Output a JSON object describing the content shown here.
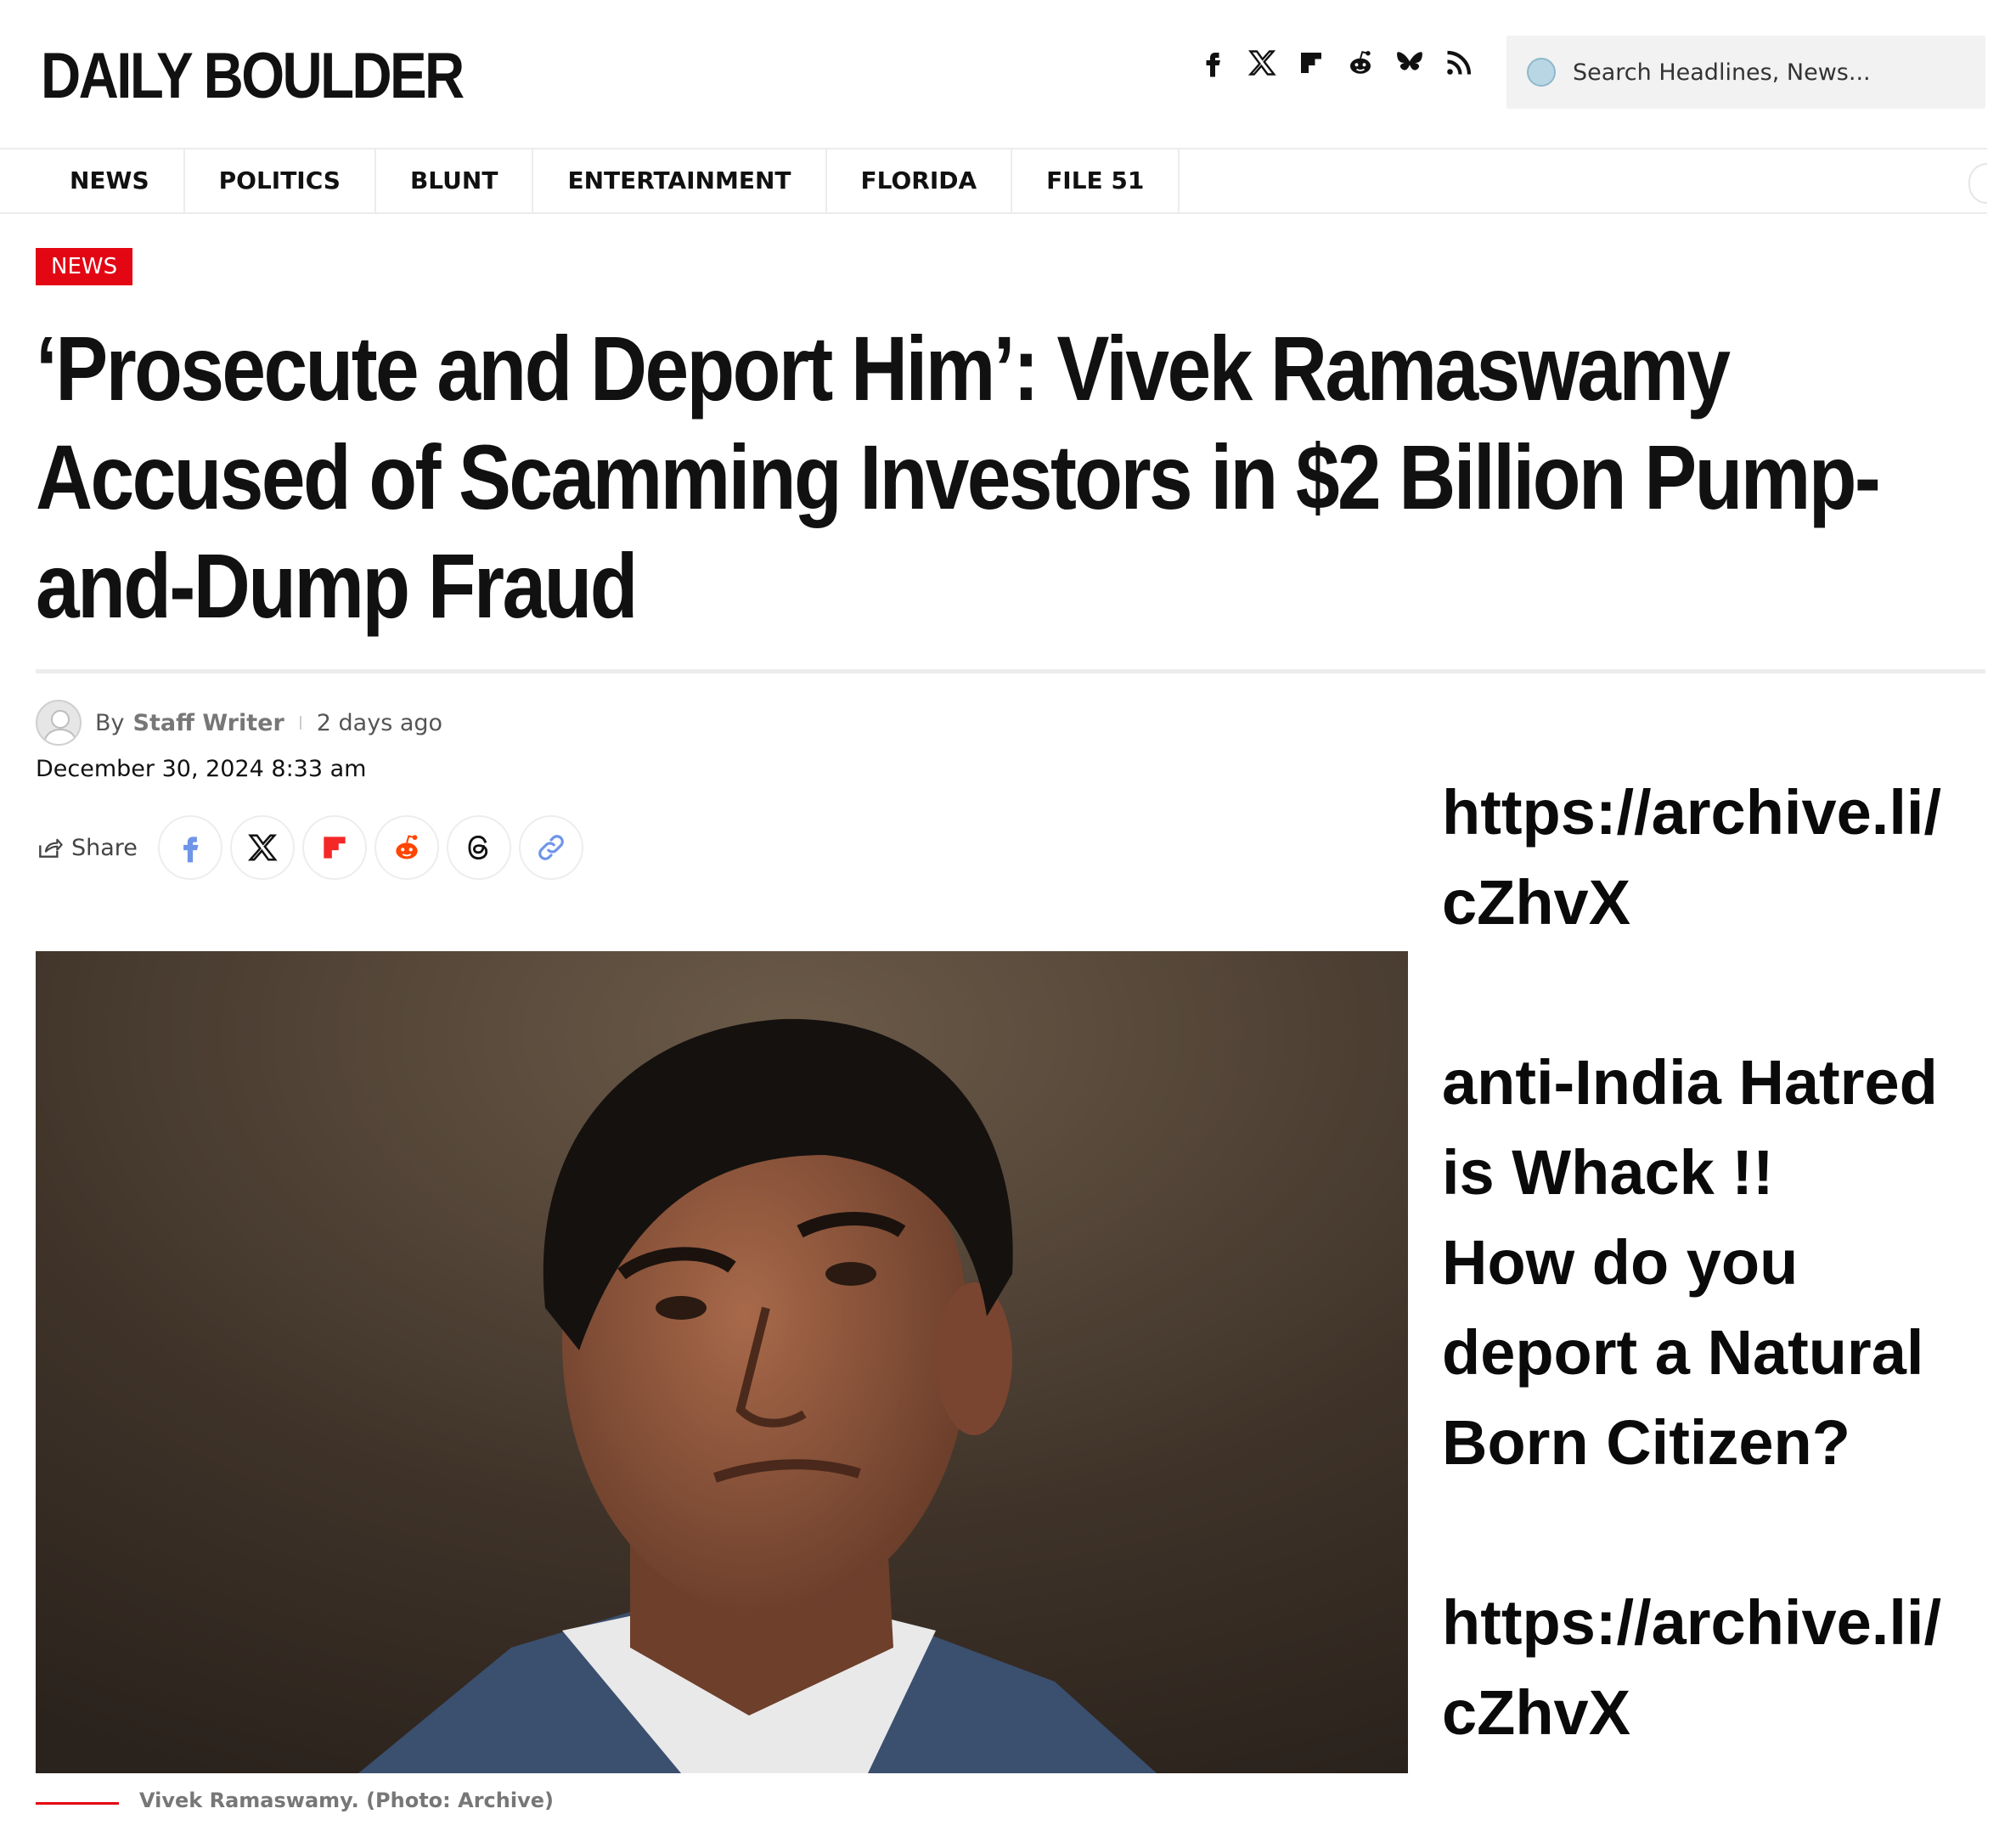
{
  "header": {
    "logo": "DAILY BOULDER",
    "social_icons": [
      "facebook-icon",
      "x-icon",
      "flipboard-icon",
      "reddit-icon",
      "bluesky-icon",
      "rss-icon"
    ],
    "search_placeholder": "Search Headlines, News..."
  },
  "nav": {
    "items": [
      "NEWS",
      "POLITICS",
      "BLUNT",
      "ENTERTAINMENT",
      "FLORIDA",
      "FILE 51"
    ]
  },
  "article": {
    "category": "NEWS",
    "headline": "‘Prosecute and Deport Him’: Vivek Ramaswamy Accused of Scamming Investors in $2 Billion Pump-and-Dump Fraud",
    "by": "By",
    "author": "Staff Writer",
    "time_ago": "2 days ago",
    "date": "December 30, 2024 8:33 am",
    "share_label": "Share",
    "share_buttons": [
      "facebook-icon",
      "x-icon",
      "flipboard-icon",
      "reddit-icon",
      "threads-icon",
      "link-icon"
    ],
    "caption": "Vivek Ramaswamy. (Photo: Archive)"
  },
  "overlay": {
    "link_top": "https://archive.li/\ncZhvX",
    "message": "anti-India Hatred\nis Whack !!\nHow do you\ndeport a Natural\nBorn Citizen?",
    "link_bottom": "https://archive.li/\ncZhvX"
  },
  "colors": {
    "accent_red": "#e30613",
    "text": "#111111",
    "nav_border": "#ececec"
  }
}
